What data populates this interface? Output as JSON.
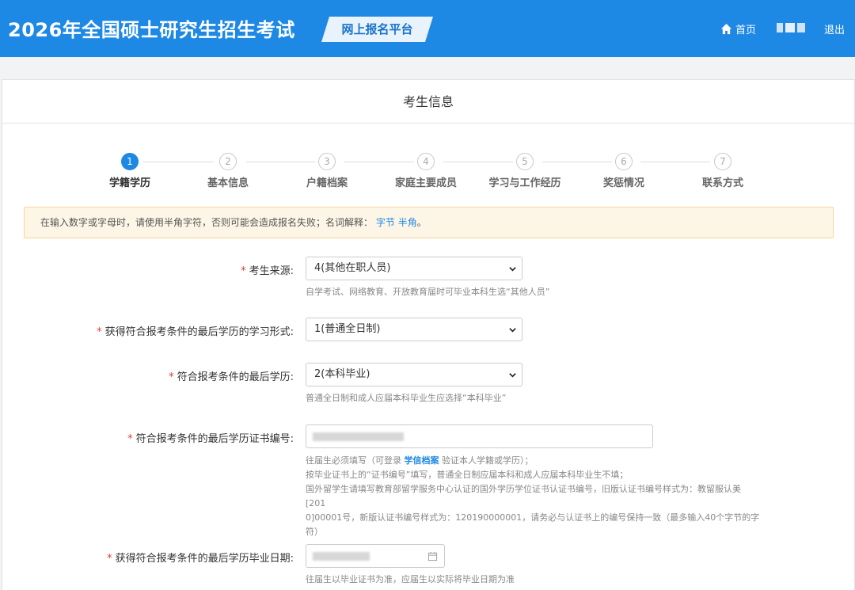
{
  "header": {
    "title": "2026年全国硕士研究生招生考试",
    "platform": "网上报名平台",
    "home_label": "首页",
    "logout_label": "退出"
  },
  "card": {
    "title": "考生信息"
  },
  "steps": [
    {
      "number": "1",
      "label": "学籍学历",
      "active": true
    },
    {
      "number": "2",
      "label": "基本信息",
      "active": false
    },
    {
      "number": "3",
      "label": "户籍档案",
      "active": false
    },
    {
      "number": "4",
      "label": "家庭主要成员",
      "active": false
    },
    {
      "number": "5",
      "label": "学习与工作经历",
      "active": false
    },
    {
      "number": "6",
      "label": "奖惩情况",
      "active": false
    },
    {
      "number": "7",
      "label": "联系方式",
      "active": false
    }
  ],
  "notice": {
    "text": "在输入数字或字母时，请使用半角字符，否则可能会造成报名失败；名词解释：",
    "link1": "字节",
    "link2": "半角",
    "end": "。"
  },
  "form": {
    "required_mark": "*",
    "source": {
      "label": "考生来源:",
      "value": "4(其他在职人员)",
      "help": "自学考试、网络教育、开放教育届时可毕业本科生选“其他人员”"
    },
    "study_form": {
      "label": "获得符合报考条件的最后学历的学习形式:",
      "value": "1(普通全日制)"
    },
    "last_degree": {
      "label": "符合报考条件的最后学历:",
      "value": "2(本科毕业)",
      "help": "普通全日制和成人应届本科毕业生应选择“本科毕业”"
    },
    "certificate": {
      "label": "符合报考条件的最后学历证书编号:",
      "help_prefix": "往届生必须填写（可登录",
      "help_link": "学信档案",
      "help_suffix": "验证本人学籍或学历）；",
      "help_line2": "按毕业证书上的“证书编号”填写，普通全日制应届本科和成人应届本科毕业生不填；",
      "help_line3": "国外留学生请填写教育部留学服务中心认证的国外学历学位证书认证书编号，旧版认证书编号样式为：教留服认美[201",
      "help_line4": "0]00001号，新版认证书编号样式为：120190000001，请务必与认证书上的编号保持一致（最多输入40个字节的字",
      "help_line5": "符）"
    },
    "grad_date": {
      "label": "获得符合报考条件的最后学历毕业日期:",
      "help": "往届生以毕业证书为准，应届生以实际将毕业日期为准"
    }
  }
}
